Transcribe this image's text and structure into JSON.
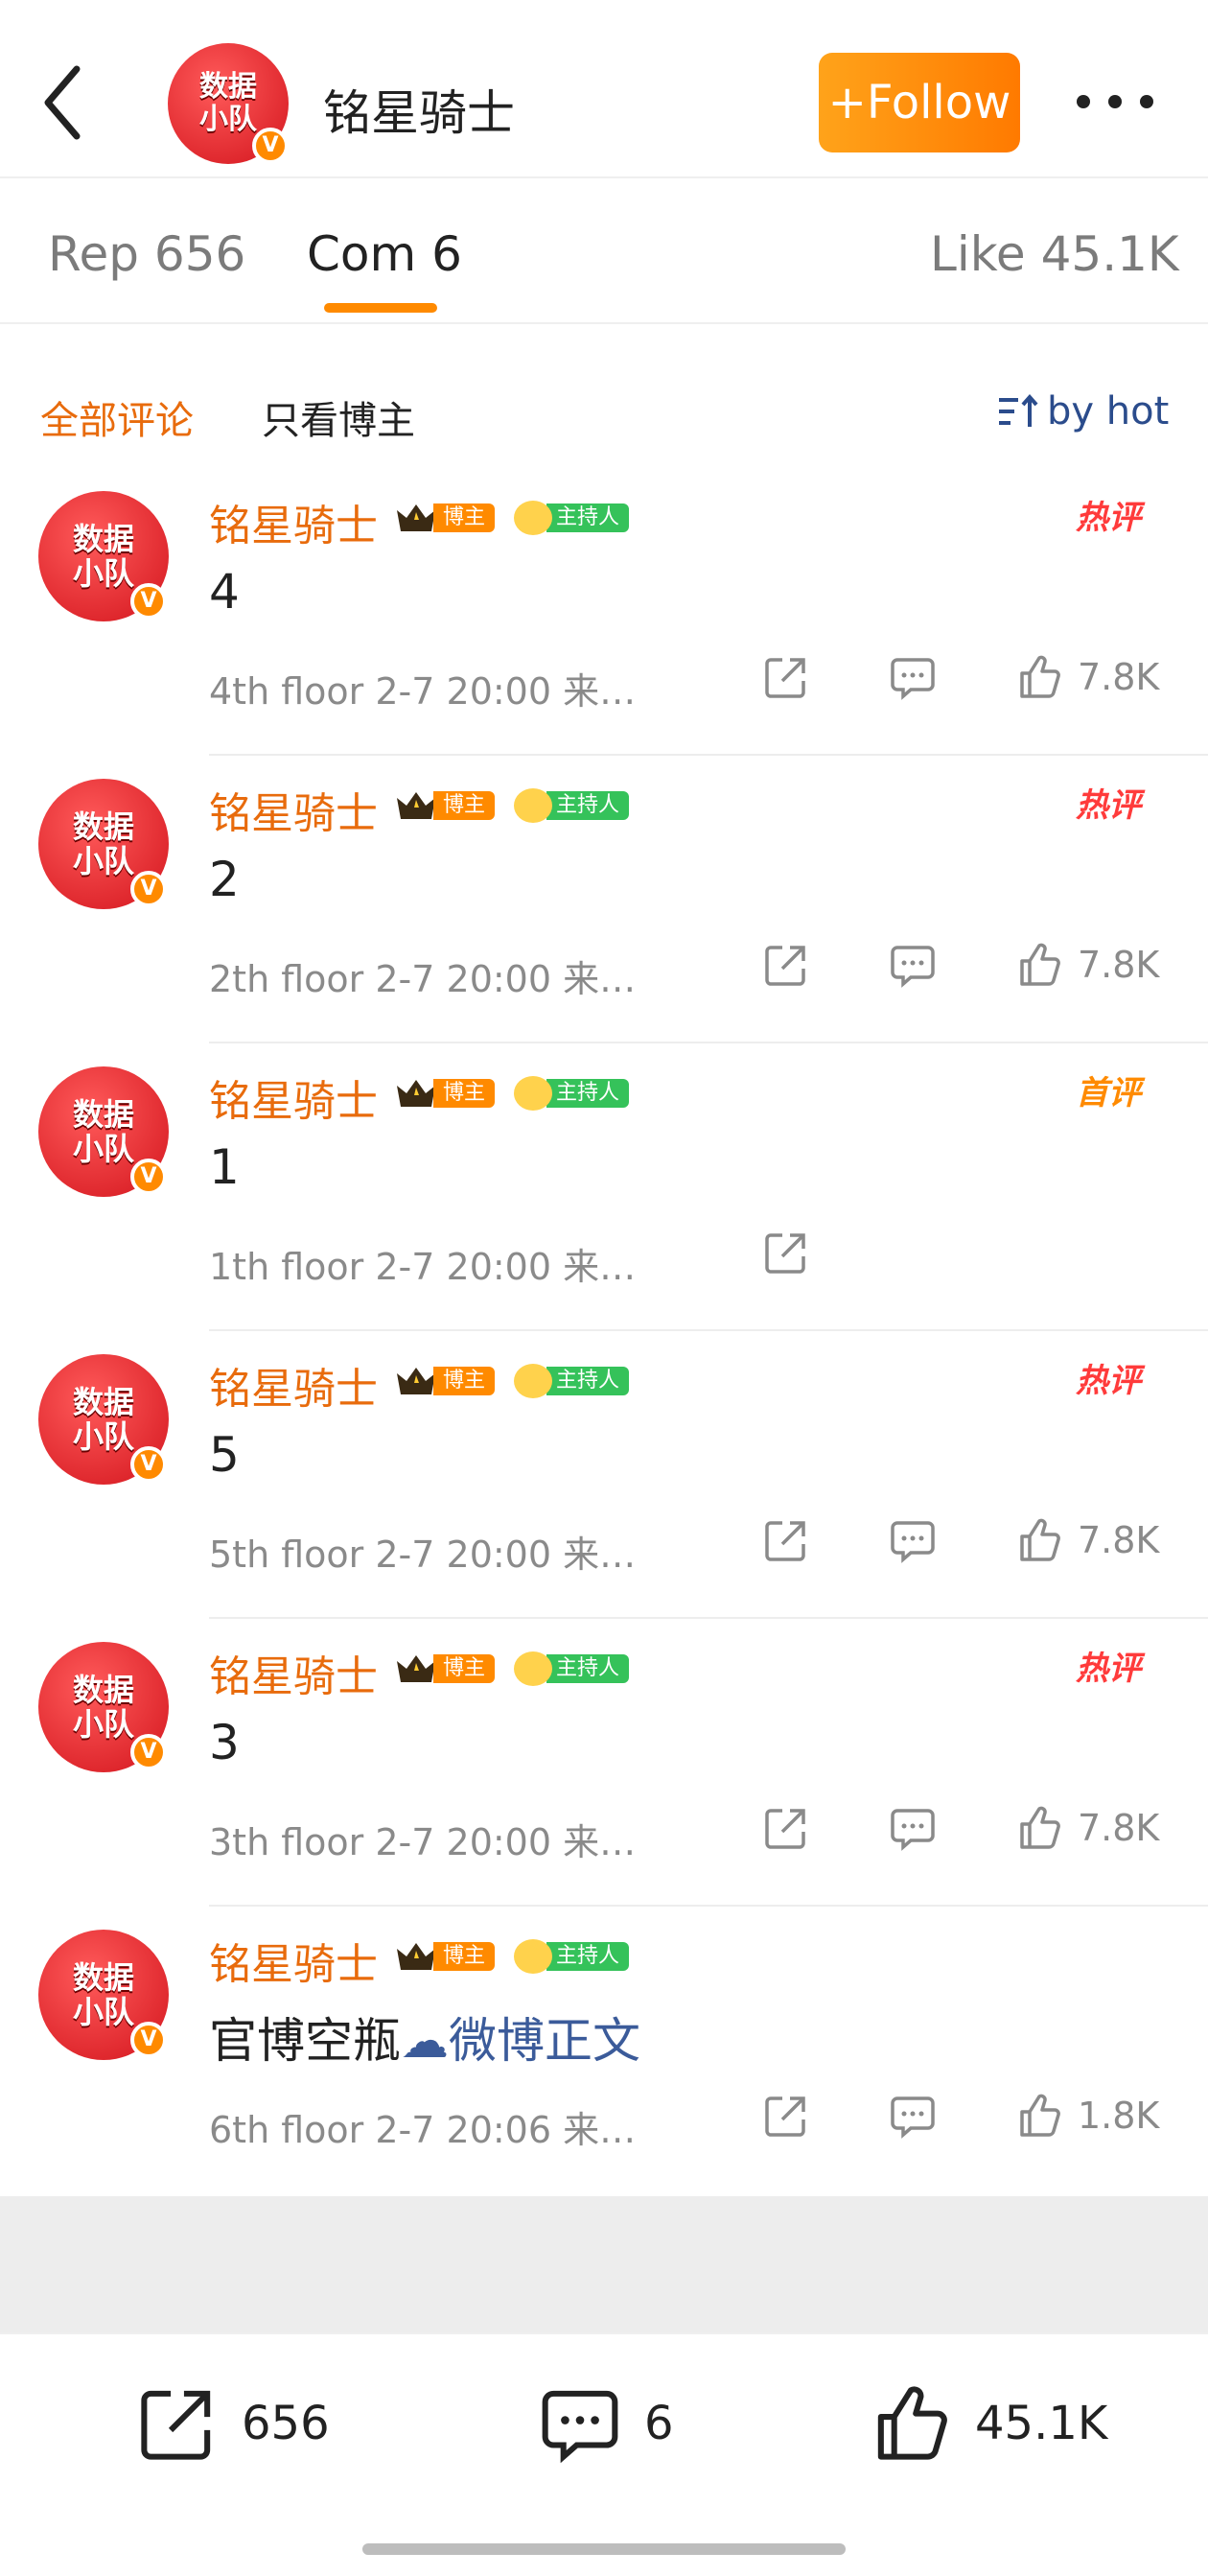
{
  "header": {
    "title": "铭星骑士",
    "follow_label": "+Follow",
    "logo": {
      "line1": "数据",
      "line2": "小队",
      "line3": "铭星骑士",
      "verified": "V"
    }
  },
  "tabs": {
    "reposts": "Rep 656",
    "comments": "Com 6",
    "likes": "Like 45.1K"
  },
  "filter": {
    "all": "全部评论",
    "owner_only": "只看博主",
    "sort": "by hot"
  },
  "badges": {
    "blogger": "博主",
    "host": "主持人"
  },
  "comments": [
    {
      "name": "铭星骑士",
      "text": "4",
      "meta": "4th floor  2-7 20:00  来…",
      "likes": "7.8K",
      "tag": "热评"
    },
    {
      "name": "铭星骑士",
      "text": "2",
      "meta": "2th floor  2-7 20:00  来…",
      "likes": "7.8K",
      "tag": "热评"
    },
    {
      "name": "铭星骑士",
      "text": "1",
      "meta": "1th floor  2-7 20:00  来…",
      "likes": "",
      "tag": "首评"
    },
    {
      "name": "铭星骑士",
      "text": "5",
      "meta": "5th floor  2-7 20:00  来…",
      "likes": "7.8K",
      "tag": "热评"
    },
    {
      "name": "铭星骑士",
      "text": "3",
      "meta": "3th floor  2-7 20:00  来…",
      "likes": "7.8K",
      "tag": "热评"
    },
    {
      "name": "铭星骑士",
      "text": "官博空瓶",
      "link": "微博正文",
      "meta": "6th floor  2-7 20:06  来…",
      "likes": "1.8K",
      "tag": ""
    }
  ],
  "bottom_bar": {
    "reposts": "656",
    "comments": "6",
    "likes": "45.1K"
  },
  "colors": {
    "accent": "#ff8a00",
    "name": "#e86b0c",
    "hot": "#ff3b3b",
    "link": "#3b5b9a"
  }
}
